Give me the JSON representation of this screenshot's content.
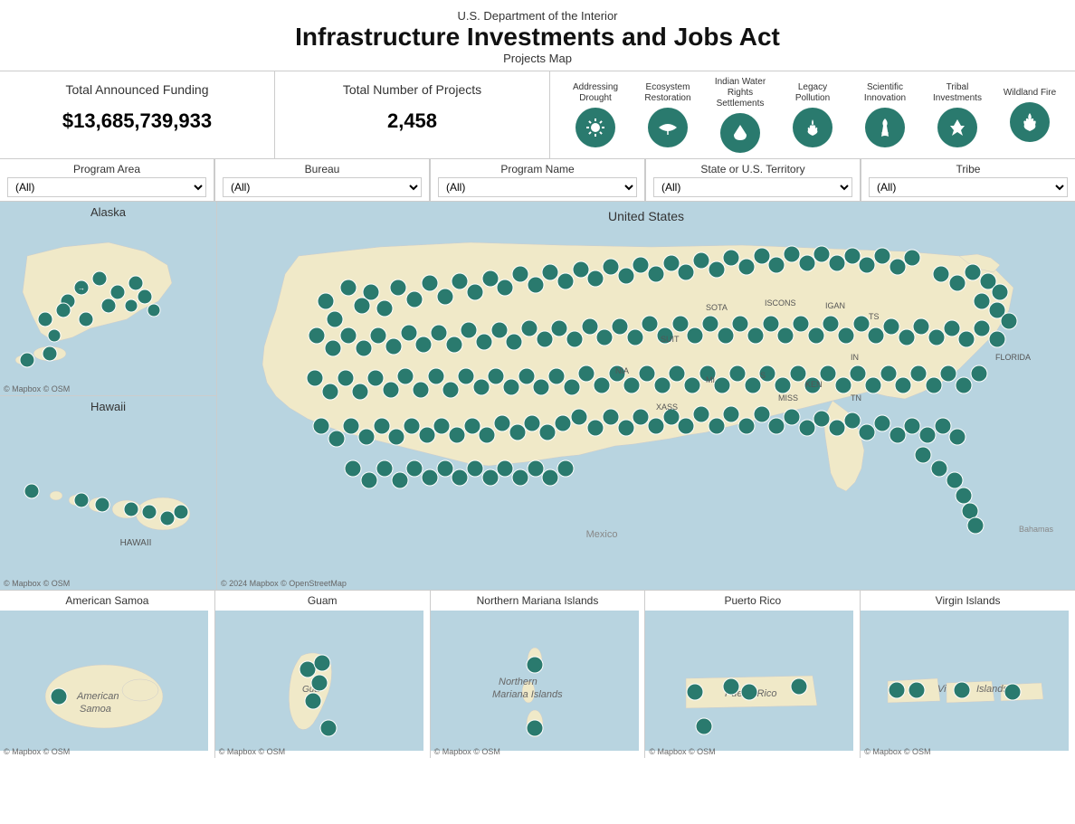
{
  "header": {
    "agency": "U.S. Department of the Interior",
    "title": "Infrastructure Investments and Jobs Act",
    "subtitle": "Projects Map"
  },
  "stats": {
    "funding_label": "Total Announced Funding",
    "funding_value": "$13,685,739,933",
    "projects_label": "Total Number of  Projects",
    "projects_value": "2,458"
  },
  "program_icons": [
    {
      "id": "drought",
      "label": "Addressing Drought",
      "symbol": "☀"
    },
    {
      "id": "ecosystem",
      "label": "Ecosystem Restoration",
      "symbol": "🐟"
    },
    {
      "id": "water",
      "label": "Indian Water Rights Settlements",
      "symbol": "💧"
    },
    {
      "id": "legacy",
      "label": "Legacy Pollution",
      "symbol": "🔥"
    },
    {
      "id": "scientific",
      "label": "Scientific Innovation",
      "symbol": "💡"
    },
    {
      "id": "tribal",
      "label": "Tribal Investments",
      "symbol": "✒"
    },
    {
      "id": "wildland",
      "label": "Wildland Fire",
      "symbol": "🔥"
    }
  ],
  "filters": {
    "program_area": {
      "label": "Program Area",
      "value": "(All)"
    },
    "bureau": {
      "label": "Bureau",
      "value": "(All)"
    },
    "program_name": {
      "label": "Program Name",
      "value": "(All)"
    },
    "state": {
      "label": "State or U.S. Territory",
      "value": "(All)"
    },
    "tribe": {
      "label": "Tribe",
      "value": "(All)"
    }
  },
  "maps": {
    "alaska": "Alaska",
    "hawaii": "Hawaii",
    "united_states": "United States",
    "american_samoa": "American Samoa",
    "guam": "Guam",
    "northern_mariana": "Northern Mariana Islands",
    "puerto_rico": "Puerto Rico",
    "virgin_islands": "Virgin Islands"
  },
  "credits": {
    "mapbox": "© Mapbox © OSM",
    "mapbox_2024": "© 2024 Mapbox © OpenStreetMap",
    "mexico_label": "Mexico",
    "bahamas_label": "Bahamas"
  }
}
